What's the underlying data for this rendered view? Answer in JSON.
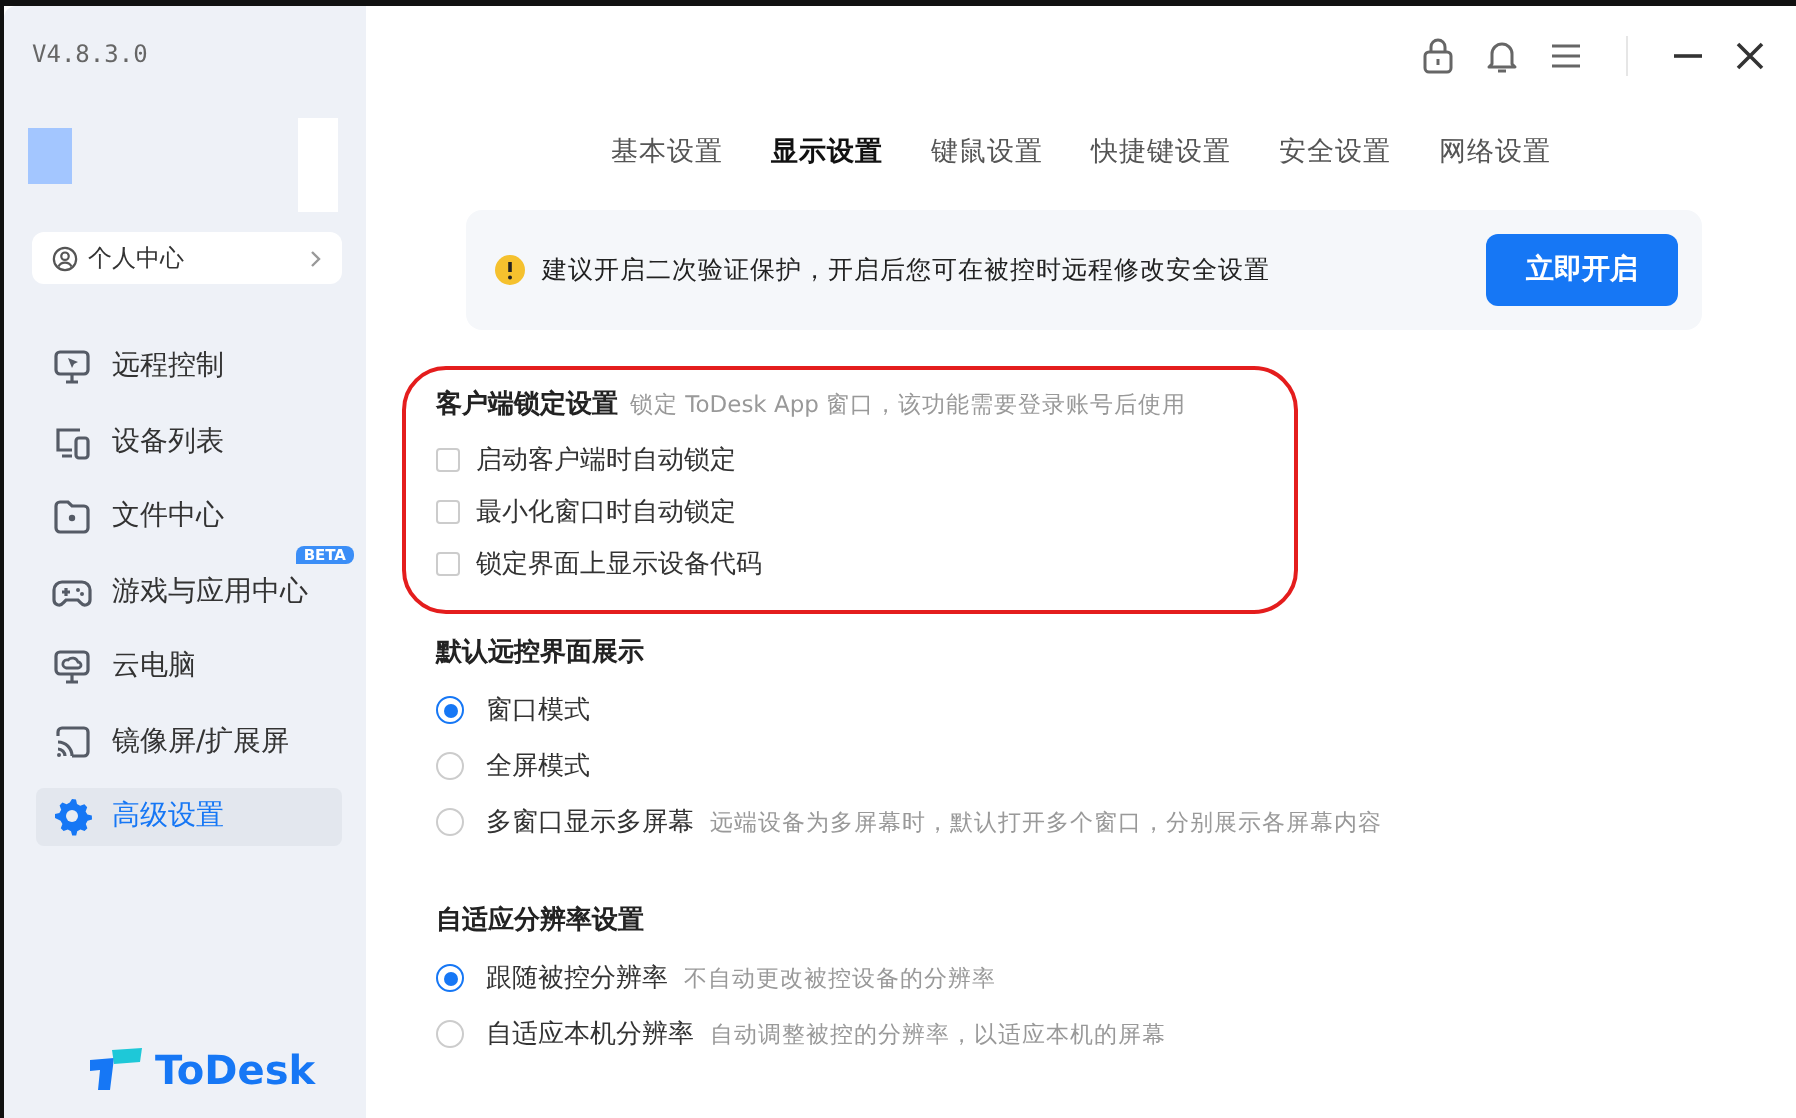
{
  "version": "V4.8.3.0",
  "profile": {
    "label": "个人中心"
  },
  "nav": [
    {
      "label": "远程控制",
      "selected": false
    },
    {
      "label": "设备列表",
      "selected": false
    },
    {
      "label": "文件中心",
      "selected": false
    },
    {
      "label": "游戏与应用中心",
      "selected": false,
      "badge": "BETA"
    },
    {
      "label": "云电脑",
      "selected": false
    },
    {
      "label": "镜像屏/扩展屏",
      "selected": false
    },
    {
      "label": "高级设置",
      "selected": true
    }
  ],
  "logo": "ToDesk",
  "tabs": [
    {
      "label": "基本设置",
      "selected": false
    },
    {
      "label": "显示设置",
      "selected": true
    },
    {
      "label": "键鼠设置",
      "selected": false
    },
    {
      "label": "快捷键设置",
      "selected": false
    },
    {
      "label": "安全设置",
      "selected": false
    },
    {
      "label": "网络设置",
      "selected": false
    }
  ],
  "banner": {
    "text": "建议开启二次验证保护，开启后您可在被控时远程修改安全设置",
    "button": "立即开启"
  },
  "sections": [
    {
      "title": "客户端锁定设置",
      "hint": "锁定 ToDesk App 窗口，该功能需要登录账号后使用",
      "highlighted": true,
      "options": [
        {
          "kind": "checkbox",
          "label": "启动客户端时自动锁定",
          "checked": false
        },
        {
          "kind": "checkbox",
          "label": "最小化窗口时自动锁定",
          "checked": false
        },
        {
          "kind": "checkbox",
          "label": "锁定界面上显示设备代码",
          "checked": false
        }
      ]
    },
    {
      "title": "默认远控界面展示",
      "highlighted": false,
      "options": [
        {
          "kind": "radio",
          "label": "窗口模式",
          "selected": true
        },
        {
          "kind": "radio",
          "label": "全屏模式",
          "selected": false
        },
        {
          "kind": "radio",
          "label": "多窗口显示多屏幕",
          "selected": false,
          "hint": "远端设备为多屏幕时，默认打开多个窗口，分别展示各屏幕内容"
        }
      ]
    },
    {
      "title": "自适应分辨率设置",
      "highlighted": false,
      "options": [
        {
          "kind": "radio",
          "label": "跟随被控分辨率",
          "selected": true,
          "hint": "不自动更改被控设备的分辨率"
        },
        {
          "kind": "radio",
          "label": "自适应本机分辨率",
          "selected": false,
          "hint": "自动调整被控的分辨率，以适应本机的屏幕"
        }
      ]
    }
  ]
}
